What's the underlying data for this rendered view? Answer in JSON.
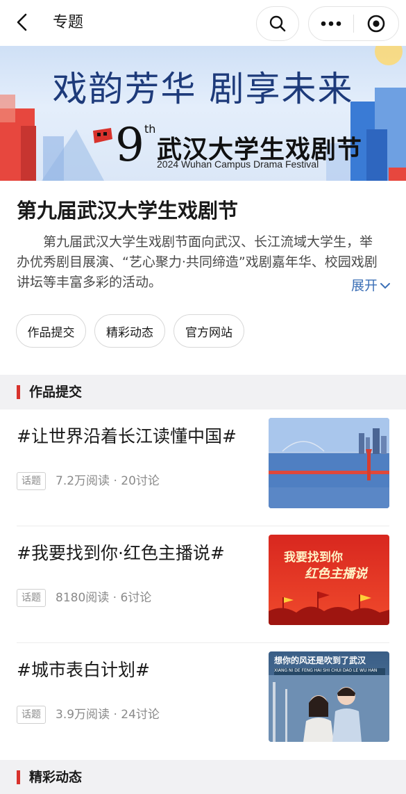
{
  "nav": {
    "title": "专题"
  },
  "banner": {
    "slogan": "戏韵芳华 剧享未来",
    "edition_number": "9",
    "edition_suffix": "th",
    "festival_cn": "武汉大学生戏剧节",
    "festival_en": "2024 Wuhan Campus Drama Festival"
  },
  "intro": {
    "title": "第九届武汉大学生戏剧节",
    "description": "第九届武汉大学生戏剧节面向武汉、长江流域大学生，举办优秀剧目展演、“艺心聚力·共同缔造”戏剧嘉年华、校园戏剧讲坛等丰富多彩的活动。",
    "expand_label": "展开"
  },
  "pills": [
    "作品提交",
    "精彩动态",
    "官方网站"
  ],
  "sections": [
    {
      "label": "作品提交"
    },
    {
      "label": "精彩动态"
    }
  ],
  "topics": [
    {
      "title": "#让世界沿着长江读懂中国#",
      "tag": "话题",
      "stats": "7.2万阅读 · 20讨论"
    },
    {
      "title": "#我要找到你·红色主播说#",
      "tag": "话题",
      "stats": "8180阅读 · 6讨论",
      "thumb_text_1": "我要找到你",
      "thumb_text_2": "红色主播说"
    },
    {
      "title": "#城市表白计划#",
      "tag": "话题",
      "stats": "3.9万阅读 · 24讨论",
      "thumb_text_1": "想你的风还是吹到了武汉",
      "thumb_text_2": "XIANG NI DE FENG HAI SHI CHUI DAO LE WU HAN"
    }
  ],
  "colors": {
    "accent_red": "#d8322c",
    "link_blue": "#3b6fb6",
    "section_bg": "#f1f1f3"
  }
}
